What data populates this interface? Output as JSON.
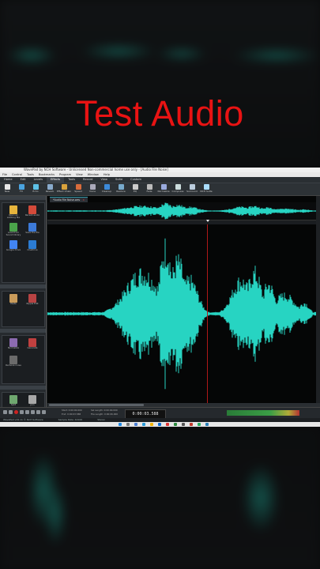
{
  "headline": "Test Audio",
  "window": {
    "title": "WavePad by NCH Software - Unlicensed Non-commercial home use only - [Audio File Noise]"
  },
  "menu": [
    "File",
    "Control",
    "Tools",
    "Bookmarks",
    "Program",
    "View",
    "Window",
    "Help"
  ],
  "tabs": [
    {
      "label": "Home",
      "active": false
    },
    {
      "label": "Edit",
      "active": false
    },
    {
      "label": "Levels",
      "active": false
    },
    {
      "label": "Effects",
      "active": true
    },
    {
      "label": "Tools",
      "active": false
    },
    {
      "label": "Record",
      "active": false
    },
    {
      "label": "View",
      "active": false
    },
    {
      "label": "Suite",
      "active": false
    },
    {
      "label": "Custom",
      "active": false
    }
  ],
  "toolbar": [
    {
      "label": "New",
      "icon": "new-file-icon",
      "color": "#e7e7e7"
    },
    {
      "label": "FX",
      "icon": "fx-icon",
      "color": "#4aa3df"
    },
    {
      "label": "Echo",
      "icon": "echo-icon",
      "color": "#5dc1e6"
    },
    {
      "label": "Reverb",
      "icon": "reverb-icon",
      "color": "#8ac"
    },
    {
      "label": "Effect Chain",
      "icon": "effect-chain-icon",
      "color": "#d9a23c"
    },
    {
      "label": "Speed",
      "icon": "speed-icon",
      "color": "#d96c3c"
    },
    {
      "label": "Voice",
      "icon": "voice-icon",
      "color": "#aab"
    },
    {
      "label": "Cleanup",
      "icon": "cleanup-icon",
      "color": "#3c8ad9"
    },
    {
      "label": "Restore",
      "icon": "restore-icon",
      "color": "#7ac"
    },
    {
      "label": "EQ",
      "icon": "eq-icon",
      "color": "#ccc"
    },
    {
      "label": "Fade",
      "icon": "fade-icon",
      "color": "#bbb"
    },
    {
      "label": "Normalize",
      "icon": "normalize-icon",
      "color": "#9ad"
    },
    {
      "label": "Compress",
      "icon": "compress-icon",
      "color": "#cdd"
    },
    {
      "label": "Surround",
      "icon": "surround-icon",
      "color": "#bcd"
    },
    {
      "label": "NCH Suite",
      "icon": "nch-suite-icon",
      "color": "#adf"
    }
  ],
  "side_panel": {
    "section1": [
      {
        "label": "Open an existing file",
        "icon": "open-folder-icon",
        "color": "#e6b43c"
      },
      {
        "label": "Recent audio",
        "icon": "recent-audio-icon",
        "color": "#d34a3a"
      },
      {
        "label": "Load from Sound library",
        "icon": "sound-library-icon",
        "color": "#4aa34a"
      },
      {
        "label": "Save the file",
        "icon": "save-file-icon",
        "color": "#3c7ad9"
      },
      {
        "label": "Google Drive",
        "icon": "google-drive-icon",
        "color": "#4285f4"
      },
      {
        "label": "OneDrive",
        "icon": "onedrive-icon",
        "color": "#2b7cd3"
      }
    ],
    "section2": [
      {
        "label": "Paste",
        "icon": "paste-icon",
        "color": "#c99b5a"
      },
      {
        "label": "Ripple Edit",
        "icon": "ripple-edit-icon",
        "color": "#b84343"
      }
    ],
    "section3": [
      {
        "label": "Normalize",
        "icon": "normalize-panel-icon",
        "color": "#8c6bb0"
      },
      {
        "label": "Generate",
        "icon": "generate-icon",
        "color": "#c0403f"
      },
      {
        "label": "Remove noise",
        "icon": "remove-noise-icon",
        "color": "#6b6b6b"
      }
    ],
    "section4": [
      {
        "label": "Split",
        "icon": "split-icon",
        "color": "#6fa86f"
      },
      {
        "label": "Join",
        "icon": "join-icon",
        "color": "#a8a8a8"
      }
    ]
  },
  "file_tab": {
    "label": "*Audio File Noise.wav",
    "close": "×"
  },
  "transport": {
    "time": "0:00:03.588",
    "start": "Start: 0:00:00.000",
    "end": "End: 0:00:03.588",
    "sel_length": "Sel Length: 0:00:00.000",
    "file_length": "File Length: 0:00:06.000"
  },
  "status": {
    "left": "WavePad v19.11 © NCH Software",
    "sample_rate": "Sample Rate: 44100",
    "channels": "Stereo"
  },
  "colors": {
    "waveform": "#27d4c2",
    "cursor": "#b01818",
    "headline": "#e81313"
  }
}
